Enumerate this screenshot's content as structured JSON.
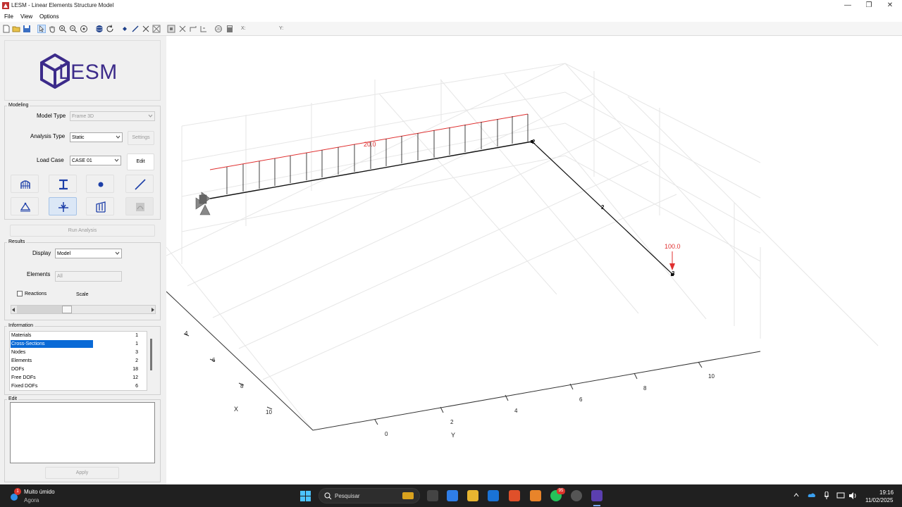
{
  "window": {
    "title": "LESM - Linear Elements Structure Model",
    "minimize": "—",
    "maximize": "❐",
    "close": "✕"
  },
  "menu": [
    "File",
    "View",
    "Options"
  ],
  "toolbar": {
    "coord_x_label": "X:",
    "coord_y_label": "Y:"
  },
  "logo": {
    "text": "LESM"
  },
  "modeling": {
    "group_label": "Modeling",
    "model_type_label": "Model Type",
    "model_type_value": "Frame 3D",
    "analysis_type_label": "Analysis Type",
    "analysis_type_value": "Static",
    "settings_label": "Settings",
    "load_case_label": "Load Case",
    "load_case_value": "CASE 01",
    "edit_label": "Edit",
    "run_analysis_label": "Run Analysis"
  },
  "results": {
    "group_label": "Results",
    "display_label": "Display",
    "display_value": "Model",
    "elements_label": "Elements",
    "elements_value": "All",
    "reactions_label": "Reactions",
    "scale_label": "Scale"
  },
  "information": {
    "group_label": "Information",
    "rows": [
      {
        "key": "Materials",
        "value": "1"
      },
      {
        "key": "Cross-Sections",
        "value": "1"
      },
      {
        "key": "Nodes",
        "value": "3"
      },
      {
        "key": "Elements",
        "value": "2"
      },
      {
        "key": "DOFs",
        "value": "18"
      },
      {
        "key": "Free DOFs",
        "value": "12"
      },
      {
        "key": "Fixed DOFs",
        "value": "6"
      }
    ],
    "selected_index": 1
  },
  "edit": {
    "group_label": "Edit",
    "apply_label": "Apply"
  },
  "plot": {
    "x_axis_label": "X",
    "y_axis_label": "Y",
    "x_ticks": [
      "4",
      "6",
      "8",
      "10"
    ],
    "y_ticks": [
      "0",
      "2",
      "4",
      "6",
      "8",
      "10"
    ],
    "distributed_load_label": "20.0",
    "point_load_label": "100.0",
    "element_label": "2",
    "node_label_2": "2",
    "node_label_3": "3",
    "load_color": "#e03030"
  },
  "taskbar": {
    "weather_title": "Muito úmido",
    "weather_sub": "Agora",
    "weather_badge": "1",
    "search_placeholder": "Pesquisar",
    "whatsapp_badge": "95",
    "time": "19:16",
    "date": "11/02/2025"
  }
}
